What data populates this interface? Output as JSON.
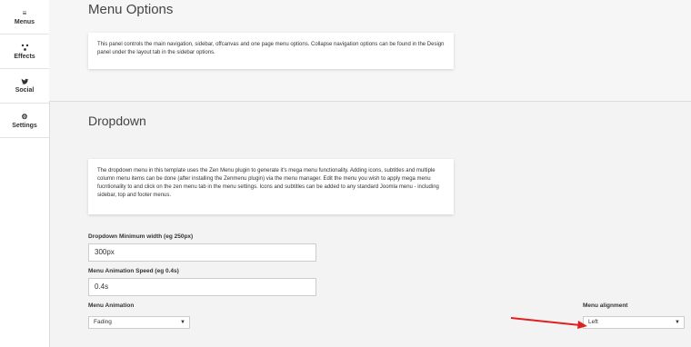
{
  "sidebar": {
    "items": [
      {
        "label": "Menus",
        "icon": "menu-icon"
      },
      {
        "label": "Effects",
        "icon": "effects-icon"
      },
      {
        "label": "Social",
        "icon": "twitter-icon"
      },
      {
        "label": "Settings",
        "icon": "gear-icon"
      }
    ]
  },
  "menu_options": {
    "title": "Menu Options",
    "description": "This panel controls the main navigation, sidebar, offcanvas and one page menu options. Collapse navigation options can be found in the Design panel under the layout tab in the sidebar options."
  },
  "dropdown": {
    "title": "Dropdown",
    "description": "The dropdown menu in this template uses the Zen Menu plugin to generate it's mega menu functionality. Adding icons, subtitles and multiple column menu items can be done (after installing the Zenmenu plugin) via the menu manager. Edit the menu you wish to apply mega menu fucntionality to and click on the zen menu tab in the menu settings. Icons and subtitles can be added to any standard Joomla menu - including sidebar, top and footer menus."
  },
  "form": {
    "min_width": {
      "label": "Dropdown Minimum width (eg 250px)",
      "value": "300px"
    },
    "anim_speed": {
      "label": "Menu Animation Speed (eg 0.4s)",
      "value": "0.4s"
    },
    "animation": {
      "label": "Menu Animation",
      "value": "Fading"
    },
    "alignment": {
      "label": "Menu alignment",
      "value": "Left"
    }
  },
  "colors": {
    "annotation_arrow": "#e02020"
  }
}
